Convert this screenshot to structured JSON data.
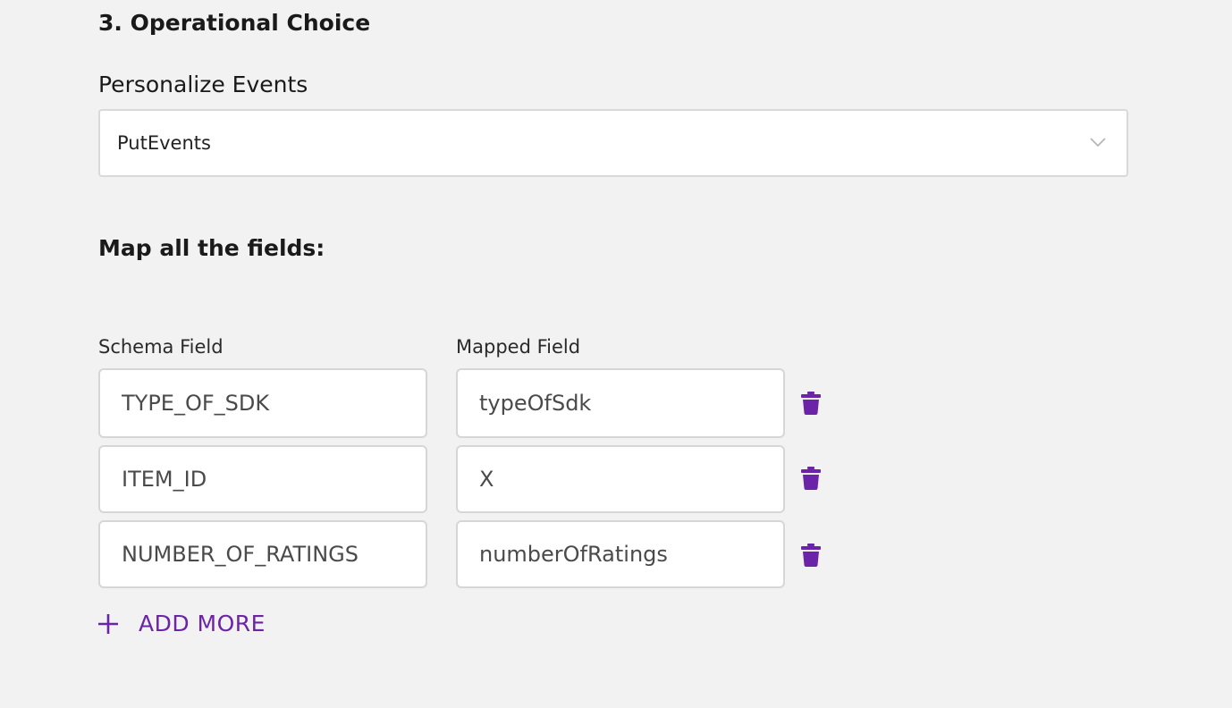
{
  "section": {
    "title": "3. Operational Choice"
  },
  "personalize": {
    "label": "Personalize Events",
    "selected": "PutEvents"
  },
  "mapping": {
    "title": "Map all the fields:",
    "schema_header": "Schema Field",
    "mapped_header": "Mapped Field",
    "rows": [
      {
        "schema": "TYPE_OF_SDK",
        "mapped": "typeOfSdk"
      },
      {
        "schema": "ITEM_ID",
        "mapped": "X"
      },
      {
        "schema": "NUMBER_OF_RATINGS",
        "mapped": "numberOfRatings"
      }
    ],
    "add_more_label": "ADD MORE"
  },
  "icons": {
    "select_arrow": "chevron-down-icon",
    "delete": "trash-icon",
    "add": "plus-icon"
  },
  "colors": {
    "accent": "#6b24a8",
    "background": "#f2f2f2",
    "input_border": "#d6d6d6"
  }
}
